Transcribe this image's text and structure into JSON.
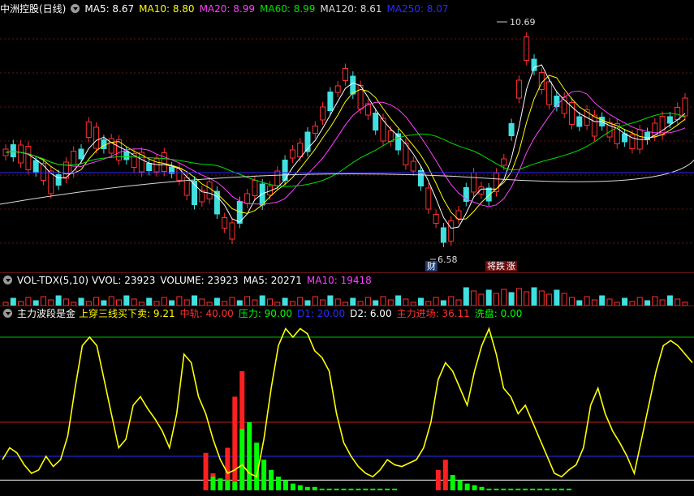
{
  "main_panel": {
    "title": "中洲控股(日线)",
    "indicators": [
      {
        "label": "MA5: 8.67",
        "color": "#ffffff"
      },
      {
        "label": "MA10: 8.80",
        "color": "#ffff00"
      },
      {
        "label": "MA20: 8.99",
        "color": "#ff40ff"
      },
      {
        "label": "MA60: 8.99",
        "color": "#00e000"
      },
      {
        "label": "MA120: 8.61",
        "color": "#dcdcdc"
      },
      {
        "label": "MA250: 8.07",
        "color": "#2a2aff"
      }
    ],
    "high_label": "10.69",
    "low_label": "6.58",
    "tags": {
      "cai": "财",
      "jiang": "将跌",
      "zhang": "涨"
    }
  },
  "volume_panel": {
    "title": "VOL-TDX(5,10)",
    "indicators": [
      {
        "label": "VVOL: 23923",
        "color": "#ffffff"
      },
      {
        "label": "VOLUME: 23923",
        "color": "#ffffff"
      },
      {
        "label": "MA5: 20271",
        "color": "#ffffff"
      },
      {
        "label": "MA10: 19418",
        "color": "#ff40ff"
      }
    ]
  },
  "osc_panel": {
    "title": "主力波段是金",
    "indicators": [
      {
        "label": "上穿三线买下卖: 9.21",
        "color": "#ffff00"
      },
      {
        "label": "中轨: 40.00",
        "color": "#ff3030"
      },
      {
        "label": "压力: 90.00",
        "color": "#00ff00"
      },
      {
        "label": "D1: 20.00",
        "color": "#2a2aff"
      },
      {
        "label": "D2: 6.00",
        "color": "#ffffff"
      },
      {
        "label": "主力进场: 36.11",
        "color": "#ff3030"
      },
      {
        "label": "洗盘: 0.00",
        "color": "#00ff00"
      }
    ]
  },
  "chart_data": {
    "type": "line",
    "title": "主力波段是金",
    "levels": {
      "中轨": 40,
      "压力": 90,
      "D1": 20,
      "D2": 6
    },
    "ylim": [
      0,
      100
    ],
    "series": [
      {
        "name": "上穿三线买下卖",
        "color": "#ffff00",
        "values": [
          18,
          25,
          22,
          15,
          10,
          12,
          20,
          14,
          18,
          32,
          60,
          85,
          90,
          85,
          65,
          45,
          25,
          30,
          50,
          55,
          48,
          42,
          35,
          25,
          45,
          80,
          75,
          55,
          45,
          30,
          18,
          10,
          12,
          15,
          10,
          8,
          30,
          60,
          85,
          95,
          90,
          95,
          92,
          82,
          78,
          70,
          45,
          28,
          20,
          14,
          10,
          8,
          12,
          18,
          15,
          14,
          16,
          18,
          25,
          40,
          65,
          75,
          70,
          60,
          50,
          70,
          85,
          95,
          80,
          60,
          55,
          45,
          50,
          40,
          30,
          20,
          10,
          8,
          12,
          15,
          25,
          50,
          60,
          45,
          35,
          28,
          20,
          10,
          30,
          50,
          70,
          85,
          88,
          85,
          80,
          75
        ]
      },
      {
        "name": "主力进场",
        "color": "#ff2020",
        "values": [
          0,
          0,
          0,
          0,
          0,
          0,
          0,
          0,
          0,
          0,
          0,
          0,
          0,
          0,
          0,
          0,
          0,
          0,
          0,
          0,
          0,
          0,
          0,
          0,
          0,
          0,
          0,
          0,
          22,
          10,
          0,
          25,
          55,
          70,
          0,
          0,
          0,
          0,
          0,
          0,
          0,
          0,
          0,
          0,
          0,
          0,
          0,
          0,
          0,
          0,
          0,
          0,
          0,
          0,
          0,
          0,
          0,
          0,
          0,
          0,
          12,
          18,
          0,
          0,
          0,
          0,
          0,
          0,
          0,
          0,
          0,
          0,
          0,
          0,
          0,
          0,
          0,
          0,
          0,
          0,
          0,
          0,
          0,
          0,
          0,
          0,
          0,
          0,
          0,
          0,
          0,
          0,
          0,
          0,
          0,
          0
        ]
      },
      {
        "name": "洗盘",
        "color": "#00ff00",
        "values": [
          0,
          0,
          0,
          0,
          0,
          0,
          0,
          0,
          0,
          0,
          0,
          0,
          0,
          0,
          0,
          0,
          0,
          0,
          0,
          0,
          0,
          0,
          0,
          0,
          0,
          0,
          0,
          0,
          0,
          8,
          7,
          6,
          5,
          36,
          40,
          28,
          18,
          12,
          8,
          6,
          4,
          3,
          2,
          2,
          1,
          1,
          1,
          1,
          1,
          1,
          1,
          1,
          1,
          1,
          1,
          0,
          0,
          0,
          0,
          0,
          0,
          0,
          9,
          6,
          4,
          3,
          2,
          1,
          1,
          1,
          1,
          1,
          1,
          1,
          1,
          1,
          1,
          1,
          1,
          0,
          0,
          0,
          0,
          0,
          0,
          0,
          0,
          0,
          0,
          0,
          0,
          0,
          0,
          0,
          0,
          0
        ]
      }
    ]
  }
}
